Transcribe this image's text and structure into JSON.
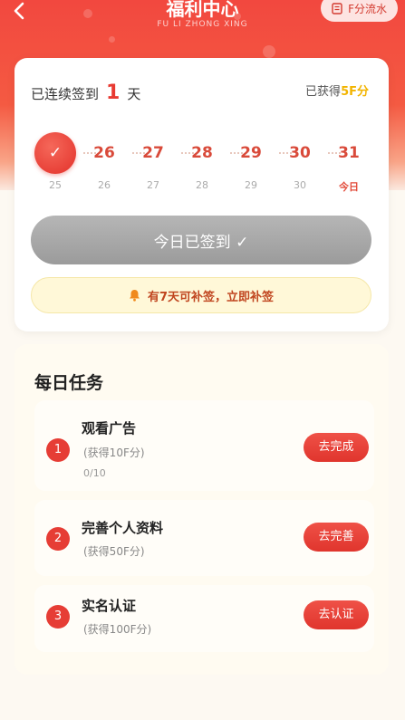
{
  "header": {
    "title": "福利中心",
    "subtitle": "FU LI ZHONG XING",
    "back_icon": "chevron-left-icon",
    "flow_button": {
      "icon": "ledger-icon",
      "label": "F分流水"
    }
  },
  "checkin": {
    "streak_prefix": "已连续签到",
    "streak_days": "1",
    "streak_suffix": "天",
    "earned_prefix": "已获得",
    "earned_points": "5F分",
    "days": [
      {
        "top": "✓",
        "bottom": "25",
        "checked": true
      },
      {
        "top": "26",
        "bottom": "26",
        "checked": false
      },
      {
        "top": "27",
        "bottom": "27",
        "checked": false
      },
      {
        "top": "28",
        "bottom": "28",
        "checked": false
      },
      {
        "top": "29",
        "bottom": "29",
        "checked": false
      },
      {
        "top": "30",
        "bottom": "30",
        "checked": false
      },
      {
        "top": "31",
        "bottom": "今日",
        "checked": false
      }
    ],
    "signed_button": "今日已签到 ✓",
    "makeup_text": "有7天可补签，立即补签",
    "makeup_icon": "bell-icon"
  },
  "tasks": {
    "title": "每日任务",
    "items": [
      {
        "index": "1",
        "name": "观看广告",
        "reward": "(获得10F分)",
        "progress": "0/10",
        "action": "去完成"
      },
      {
        "index": "2",
        "name": "完善个人资料",
        "reward": "(获得50F分)",
        "progress": "",
        "action": "去完善"
      },
      {
        "index": "3",
        "name": "实名认证",
        "reward": "(获得100F分)",
        "progress": "",
        "action": "去认证"
      }
    ]
  },
  "colors": {
    "brand_red": "#e83a32",
    "points_yellow": "#f2b400",
    "disabled_gray": "#a8a8a8"
  }
}
